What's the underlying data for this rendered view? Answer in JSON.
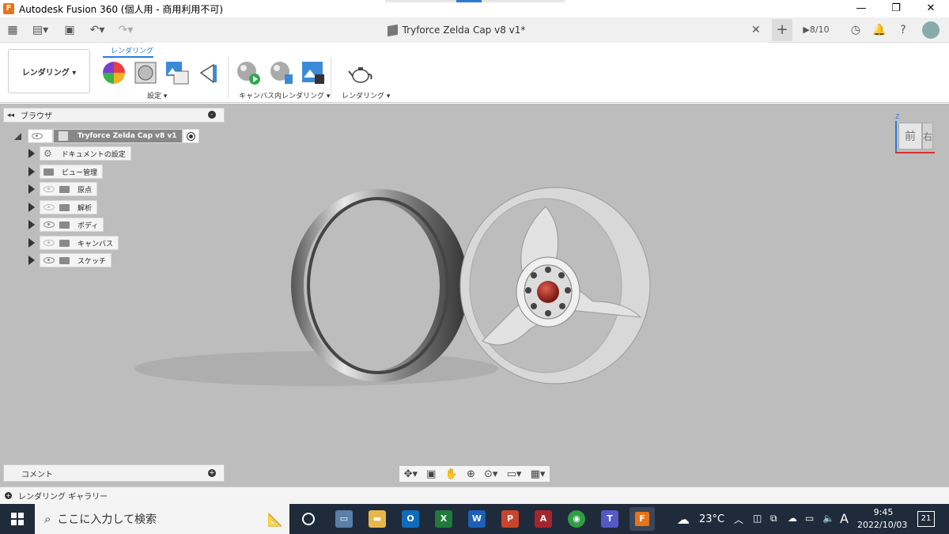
{
  "window": {
    "title": "Autodesk Fusion 360 (個人用 - 商用利用不可)",
    "app_icon": "F"
  },
  "doc_tab": {
    "title": "Tryforce Zelda Cap v8 v1*"
  },
  "header_right": {
    "job_status": "8/10"
  },
  "ribbon": {
    "workspace": "レンダリング ▾",
    "tab": "レンダリング",
    "groups": [
      {
        "label": "設定 ▾"
      },
      {
        "label": "キャンバス内レンダリング ▾"
      },
      {
        "label": "レンダリング ▾"
      }
    ]
  },
  "browser": {
    "title": "ブラウザ",
    "root": "Tryforce Zelda Cap v8 v1",
    "items": [
      {
        "label": "ドキュメントの設定",
        "icon": "gear-icon"
      },
      {
        "label": "ビュー管理",
        "icon": "folder-icon"
      },
      {
        "label": "原点",
        "icon": "folder-icon"
      },
      {
        "label": "解析",
        "icon": "folder-icon"
      },
      {
        "label": "ボディ",
        "icon": "folder-icon"
      },
      {
        "label": "キャンバス",
        "icon": "folder-icon"
      },
      {
        "label": "スケッチ",
        "icon": "folder-icon"
      }
    ]
  },
  "viewcube": {
    "z_label": "Z",
    "front_label": "前",
    "right_label": "右"
  },
  "comment": {
    "label": "コメント"
  },
  "gallery": {
    "label": "レンダリング ギャラリー"
  },
  "taskbar": {
    "search_placeholder": "ここに入力して検索",
    "weather": "23°C",
    "ime": "A",
    "time": "9:45",
    "date": "2022/10/03",
    "notifications": "21"
  },
  "colors": {
    "accent": "#2b7bd6",
    "canvas": "#bdbdbd",
    "taskbar": "#1f2a3a",
    "fusion": "#e8731a"
  }
}
